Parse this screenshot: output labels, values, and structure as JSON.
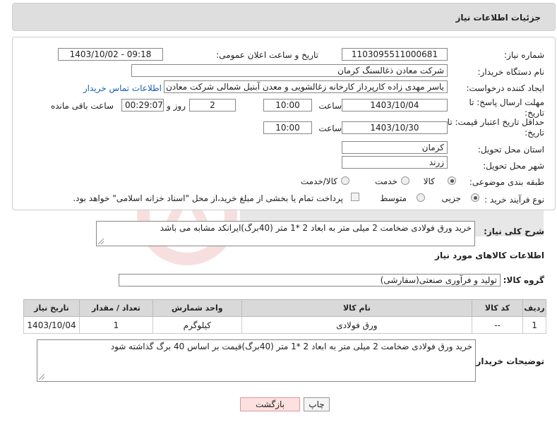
{
  "header": {
    "title": "جزئیات اطلاعات نیاز"
  },
  "form": {
    "need_number_label": "شماره نیاز:",
    "need_number": "1103095511000681",
    "announce_label": "تاریخ و ساعت اعلان عمومی:",
    "announce_value": "1403/10/02 - 09:18",
    "buyer_org_label": "نام دستگاه خریدار:",
    "buyer_org": "شرکت معادن ذغالسنگ کرمان",
    "creator_label": "ایجاد کننده درخواست:",
    "creator": "یاسر مهدی زاده کارپرداز کارخانه زغالشویی و معدن آبنیل شمالی  شرکت معادن",
    "contact_link": "اطلاعات تماس خریدار",
    "reply_deadline_label": "مهلت ارسال پاسخ: تا تاریخ:",
    "reply_date": "1403/10/04",
    "time_label": "ساعت",
    "reply_time": "10:00",
    "days_value": "2",
    "days_label": "روز و",
    "remaining_time": "00:29:07",
    "remaining_label": "ساعت باقی مانده",
    "price_validity_label": "حداقل تاریخ اعتبار قیمت: تا تاریخ:",
    "price_date": "1403/10/30",
    "price_time_label": "ساعت",
    "price_time": "10:00",
    "province_label": "استان محل تحویل:",
    "province": "کرمان",
    "city_label": "شهر محل تحویل:",
    "city": "زرند",
    "category_label": "طبقه بندی موضوعی:",
    "category_options": [
      "کالا",
      "خدمت",
      "کالا/خدمت"
    ],
    "process_label": "نوع فرآیند خرید :",
    "process_options": [
      "جزیی",
      "متوسط"
    ],
    "payment_note": "پرداخت تمام یا بخشی از مبلغ خرید،از محل \"اسناد خزانه اسلامی\" خواهد بود."
  },
  "summary": {
    "label": "شرح کلی نیاز:",
    "text": "خرید ورق فولادی ضخامت 2 میلی متر به ابعاد 2 *1 متر (40برگ)ایرانکد مشابه می باشد"
  },
  "goods": {
    "section_title": "اطلاعات کالاهای مورد نیاز",
    "group_label": "گروه کالا:",
    "group_value": "تولید و فرآوری صنعتی(سفارشی)",
    "columns": [
      "ردیف",
      "کد کالا",
      "نام کالا",
      "واحد شمارش",
      "تعداد / مقدار",
      "تاریخ نیاز"
    ],
    "rows": [
      [
        "1",
        "--",
        "ورق فولادی",
        "کیلوگرم",
        "1",
        "1403/10/04"
      ]
    ]
  },
  "buyer_notes": {
    "label": "توضیحات خریدار:",
    "text": "خرید ورق فولادی ضخامت 2 میلی متر به ابعاد 2 *1 متر (40برگ)قیمت بر اساس 40 برگ گذاشته شود"
  },
  "buttons": {
    "print": "چاپ",
    "back": "بازگشت"
  },
  "colors": {
    "header_bg": "#dedede",
    "link": "#1a5fb4",
    "back_bg": "#fde0e0"
  }
}
